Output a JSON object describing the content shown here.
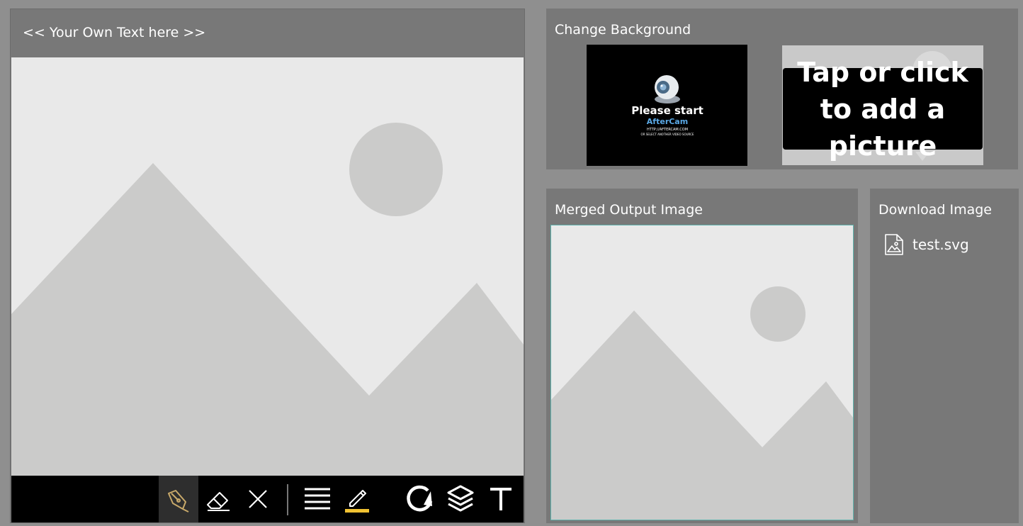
{
  "editor": {
    "title": "<< Your Own Text here >>",
    "tools": [
      {
        "icon": "pen-icon",
        "active": true
      },
      {
        "icon": "eraser-icon"
      },
      {
        "icon": "clear-icon"
      },
      {
        "icon": "line-width-icon"
      },
      {
        "icon": "pencil-color-icon",
        "accent": "#f1c232"
      },
      {
        "icon": "undo-icon"
      },
      {
        "icon": "layers-icon"
      },
      {
        "icon": "text-tool-icon"
      }
    ]
  },
  "background_panel": {
    "title": "Change Background",
    "current_bg": {
      "line1": "Please start",
      "line2": "AfterCam",
      "line3": "HTTP://AFTERCAM.COM",
      "line4": "OR SELECT ANOTHER VIDEO SOURCE"
    },
    "add_picture_label": "Tap or click to add a picture"
  },
  "merged_panel": {
    "title": "Merged Output Image"
  },
  "download_panel": {
    "title": "Download Image",
    "file_name": "test.svg"
  },
  "colors": {
    "accent": "#f1c232",
    "output_border": "#5fb3ad",
    "panel": "#787878",
    "page_bg": "#8f8f8f"
  }
}
